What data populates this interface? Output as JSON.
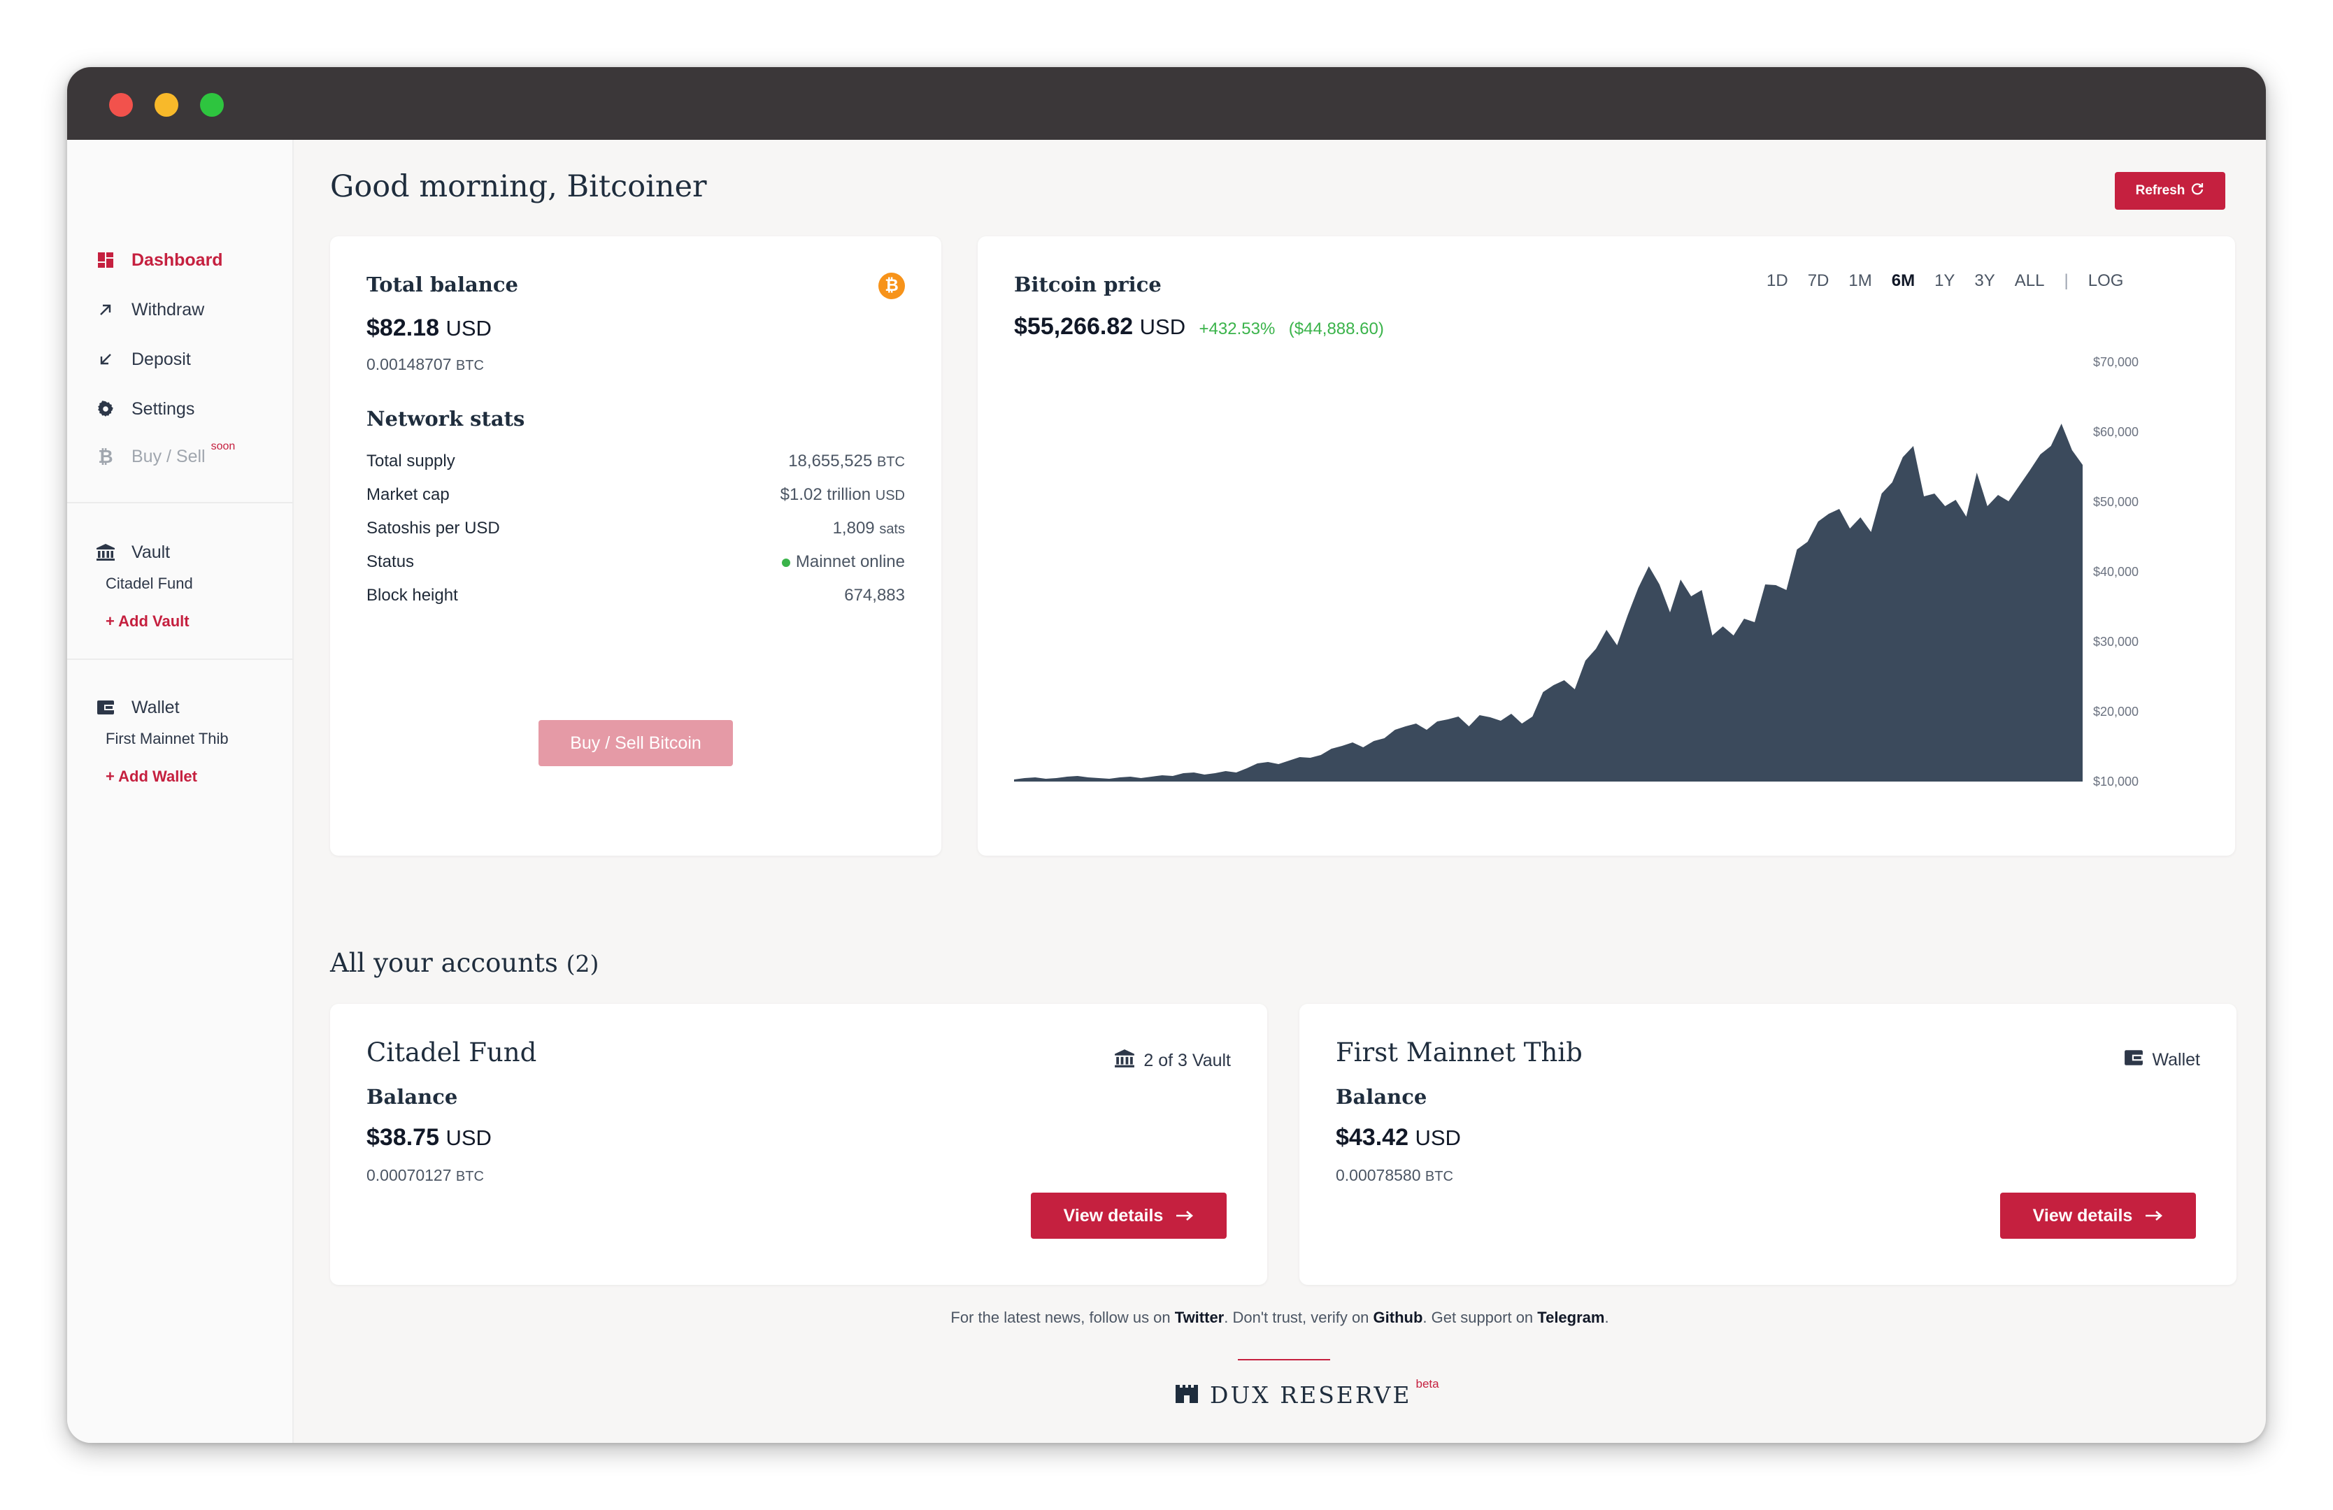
{
  "sidebar": {
    "nav": [
      {
        "label": "Dashboard",
        "icon": "dashboard-icon"
      },
      {
        "label": "Withdraw",
        "icon": "arrow-up-right-icon"
      },
      {
        "label": "Deposit",
        "icon": "arrow-down-left-icon"
      },
      {
        "label": "Settings",
        "icon": "gear-icon"
      },
      {
        "label": "Buy / Sell",
        "icon": "bitcoin-icon",
        "badge": "soon"
      }
    ],
    "vault": {
      "label": "Vault",
      "items": [
        "Citadel Fund"
      ],
      "add": "+ Add Vault"
    },
    "wallet": {
      "label": "Wallet",
      "items": [
        "First Mainnet Thib"
      ],
      "add": "+ Add Wallet"
    }
  },
  "header": {
    "greeting": "Good morning, Bitcoiner",
    "refresh": "Refresh"
  },
  "balance_card": {
    "title": "Total balance",
    "usd_value": "$82.18",
    "usd_unit": "USD",
    "btc_value": "0.00148707",
    "btc_unit": "BTC",
    "network_title": "Network stats",
    "stats": [
      {
        "label": "Total supply",
        "value": "18,655,525",
        "unit": "BTC"
      },
      {
        "label": "Market cap",
        "value": "$1.02 trillion",
        "unit": "USD"
      },
      {
        "label": "Satoshis per USD",
        "value": "1,809",
        "unit": "sats"
      },
      {
        "label": "Status",
        "value": "Mainnet online",
        "unit": ""
      },
      {
        "label": "Block height",
        "value": "674,883",
        "unit": ""
      }
    ],
    "buy_sell": "Buy / Sell Bitcoin"
  },
  "price_card": {
    "title": "Bitcoin price",
    "price": "$55,266.82",
    "unit": "USD",
    "change_pct": "+432.53%",
    "change_abs": "($44,888.60)",
    "ranges": [
      "1D",
      "7D",
      "1M",
      "6M",
      "1Y",
      "3Y",
      "ALL"
    ],
    "selected_range": "6M",
    "separator": "|",
    "log": "LOG"
  },
  "chart_data": {
    "type": "area",
    "title": "Bitcoin price",
    "xlabel": "",
    "ylabel": "",
    "ylim": [
      10000,
      70000
    ],
    "yticks": [
      "$70,000",
      "$60,000",
      "$50,000",
      "$40,000",
      "$30,000",
      "$20,000",
      "$10,000"
    ],
    "ytick_values": [
      70000,
      60000,
      50000,
      40000,
      30000,
      20000,
      10000
    ],
    "color": "#3b4a5c",
    "values": [
      10300,
      10500,
      10600,
      10400,
      10500,
      10700,
      10800,
      10600,
      10500,
      10400,
      10600,
      10700,
      10500,
      10700,
      10900,
      10800,
      11200,
      11300,
      11000,
      11200,
      11500,
      11300,
      11900,
      12600,
      12800,
      12500,
      13000,
      13500,
      13400,
      13800,
      14700,
      15100,
      15600,
      14900,
      15800,
      16200,
      17400,
      17900,
      18300,
      17400,
      18600,
      18900,
      19300,
      17900,
      19500,
      19200,
      18700,
      19700,
      18300,
      19300,
      22800,
      23800,
      24500,
      23200,
      27300,
      29000,
      31700,
      29500,
      33800,
      37700,
      40800,
      38200,
      34200,
      38900,
      36500,
      37400,
      30900,
      32200,
      30900,
      33300,
      32800,
      38200,
      38100,
      37400,
      43200,
      44300,
      47200,
      48300,
      49000,
      46200,
      47800,
      45700,
      51200,
      52800,
      56400,
      58000,
      50800,
      51200,
      49400,
      50300,
      47900,
      54200,
      49400,
      51000,
      50100,
      52300,
      54500,
      56800,
      58000,
      61200,
      57400,
      55300
    ]
  },
  "accounts": {
    "title": "All your accounts",
    "count": "(2)",
    "items": [
      {
        "name": "Citadel Fund",
        "type": "2 of 3 Vault",
        "type_icon": "vault-icon",
        "balance_label": "Balance",
        "usd_value": "$38.75",
        "usd_unit": "USD",
        "btc_value": "0.00070127",
        "btc_unit": "BTC",
        "action": "View details"
      },
      {
        "name": "First Mainnet Thib",
        "type": "Wallet",
        "type_icon": "wallet-icon",
        "balance_label": "Balance",
        "usd_value": "$43.42",
        "usd_unit": "USD",
        "btc_value": "0.00078580",
        "btc_unit": "BTC",
        "action": "View details"
      }
    ]
  },
  "footer": {
    "text1": "For the latest news, follow us on ",
    "twitter": "Twitter",
    "text2": ". Don't trust, verify on ",
    "github": "Github",
    "text3": ". Get support on ",
    "telegram": "Telegram",
    "text4": ".",
    "brand": "DUX RESERVE",
    "beta": "beta"
  },
  "colors": {
    "accent": "#c5203f",
    "chart": "#3b4a5c",
    "positive": "#3ab34a",
    "bitcoin": "#f7931a"
  }
}
